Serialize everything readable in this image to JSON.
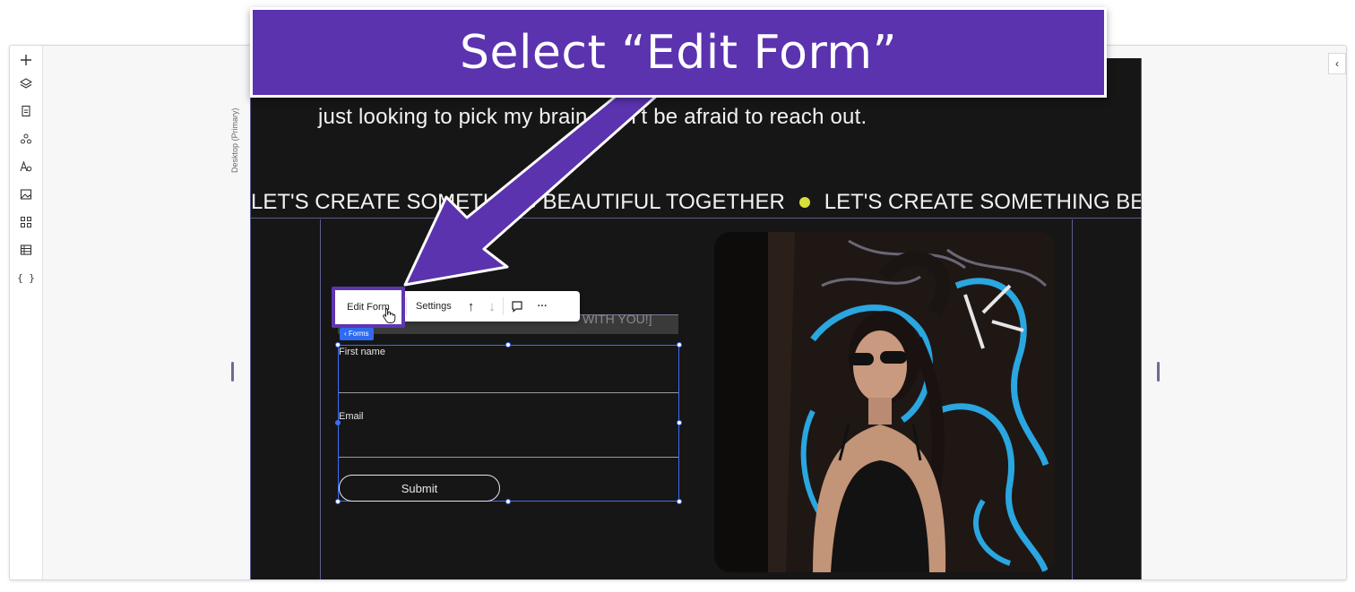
{
  "callout": {
    "text": "Select “Edit Form”"
  },
  "left_toolbar": {
    "tools": [
      {
        "name": "add-icon",
        "glyph": "+"
      },
      {
        "name": "layers-icon",
        "glyph": "◈"
      },
      {
        "name": "pages-icon",
        "glyph": "▤"
      },
      {
        "name": "apps-icon",
        "glyph": "✦"
      },
      {
        "name": "text-theme-icon",
        "glyph": "Aₒ"
      },
      {
        "name": "media-icon",
        "glyph": "▣"
      },
      {
        "name": "add-apps-icon",
        "glyph": "⊞"
      },
      {
        "name": "cms-table-icon",
        "glyph": "▦"
      },
      {
        "name": "code-icon",
        "glyph": "{ }"
      }
    ]
  },
  "breakpoint": {
    "label": "Desktop (Primary)"
  },
  "canvas": {
    "intro_text": "just looking to pick my brain, don’t be afraid to reach out.",
    "marquee_text_1": "LET'S CREATE SOMETHING BEAUTIFUL TOGETHER",
    "marquee_text_2": "LET'S CREATE SOMETHING BEAUT",
    "form_header_partial": "WITH YOU!]",
    "forms_badge": "‹ Forms",
    "fields": [
      {
        "label": "First name"
      },
      {
        "label": "Email"
      }
    ],
    "submit_label": "Submit"
  },
  "context_toolbar": {
    "edit_form_label": "Edit Form",
    "settings_label": "Settings",
    "move_up_glyph": "↑",
    "move_down_glyph": "↓",
    "comment_glyph": "☐",
    "more_glyph": "···"
  },
  "colors": {
    "callout_purple": "#5b33ae",
    "canvas_bg": "#161616",
    "selection_blue": "#3f6cf5",
    "accent_dot": "#d6e03d"
  }
}
